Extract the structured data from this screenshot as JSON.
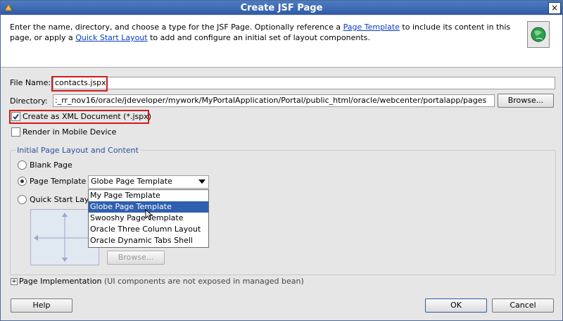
{
  "window": {
    "title": "Create JSF Page",
    "close_label": "×"
  },
  "description": {
    "part1": "Enter the name, directory, and choose a type for the JSF Page. Optionally reference a ",
    "link1": "Page Template",
    "part2": " to include its content in this page, or apply a ",
    "link2": "Quick Start Layout",
    "part3": " to add and configure an initial set of layout components."
  },
  "form": {
    "file_name_label": "File Name:",
    "file_name_value": "contacts.jspx",
    "directory_label": "Directory:",
    "directory_value": ":_rr_nov16/oracle/jdeveloper/mywork/MyPortalApplication/Portal/public_html/oracle/webcenter/portalapp/pages",
    "browse_label": "Browse...",
    "xml_doc_label": "Create as XML Document (*.jspx)",
    "mobile_label": "Render in Mobile Device"
  },
  "layout_group": {
    "title": "Initial Page Layout and Content",
    "blank_label": "Blank Page",
    "template_label": "Page Template",
    "quickstart_label": "Quick Start Layo",
    "template_selected": "Globe Page Template",
    "template_options": [
      "My Page Template",
      "Globe Page Template",
      "Swooshy Page Template",
      "Oracle Three Column Layout",
      "Oracle Dynamic Tabs Shell"
    ],
    "quickstart_browse": "Browse..."
  },
  "implementation": {
    "label": "Page Implementation",
    "note": "(UI components are not exposed in managed bean)"
  },
  "buttons": {
    "help": "Help",
    "ok": "OK",
    "cancel": "Cancel"
  },
  "colors": {
    "title_bar": "#2f5aa6",
    "highlight": "#d21a1a",
    "selection": "#2f5fae",
    "link": "#0b3cc4"
  }
}
